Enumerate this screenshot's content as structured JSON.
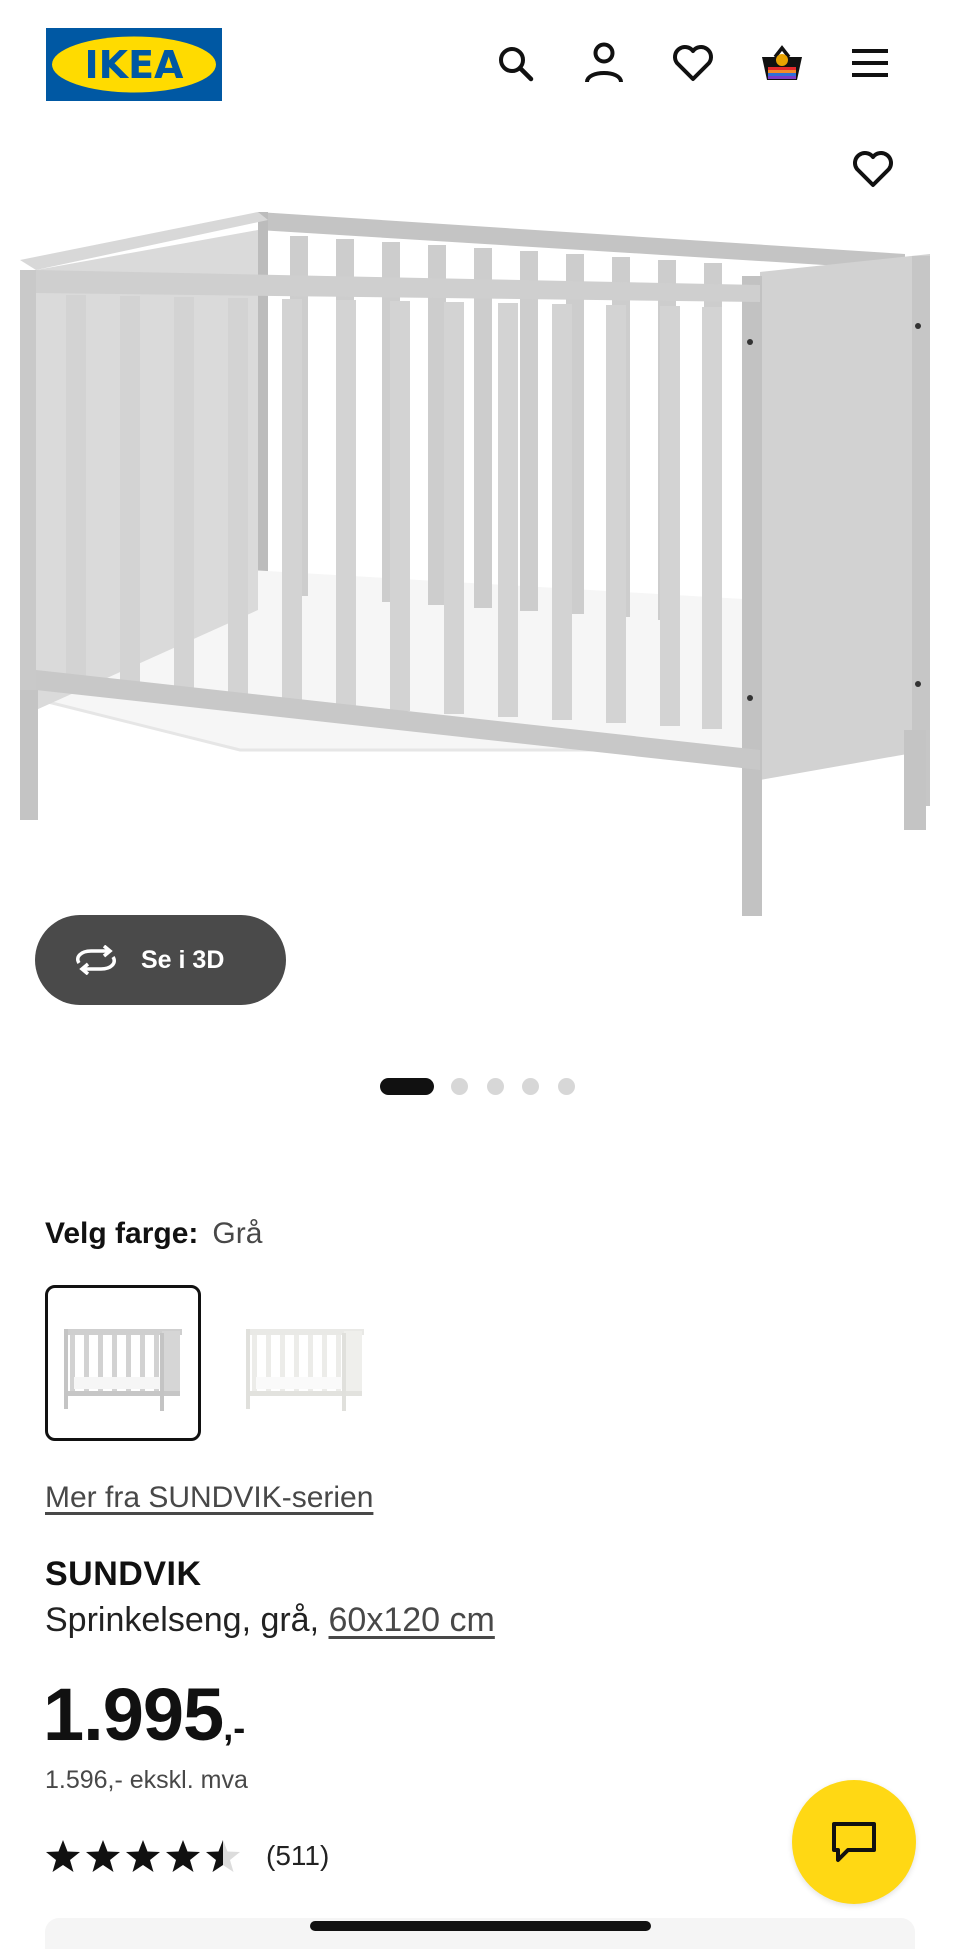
{
  "header": {
    "logo_text": "IKEA",
    "icons": [
      "search-icon",
      "account-icon",
      "heart-icon",
      "basket-icon",
      "menu-icon"
    ]
  },
  "gallery": {
    "favourite_icon": "heart-icon",
    "view_3d_label": "Se i 3D",
    "view_3d_icon": "rotate-icon",
    "dot_count": 5,
    "active_dot": 0
  },
  "color_picker": {
    "label": "Velg farge:",
    "selected_value": "Grå",
    "swatches": [
      {
        "name": "grå",
        "selected": true,
        "color": "#cfcfcf"
      },
      {
        "name": "hvit",
        "selected": false,
        "color": "#ececec"
      }
    ]
  },
  "product": {
    "series_link": "Mer fra SUNDVIK-serien",
    "name": "SUNDVIK",
    "description": "Sprinkelseng, grå, ",
    "size_link": "60x120 cm",
    "price_integer": "1.995",
    "price_suffix": ",-",
    "price_ex_vat": "1.596,- ekskl. mva",
    "rating": 4.5,
    "rating_max": 5,
    "review_count": "(511)"
  },
  "chat": {
    "icon": "chat-icon"
  },
  "colors": {
    "ikea_blue": "#0058a3",
    "ikea_yellow": "#ffdb00",
    "chat_yellow": "#ffd814",
    "button_dark": "#4a4a4a"
  }
}
